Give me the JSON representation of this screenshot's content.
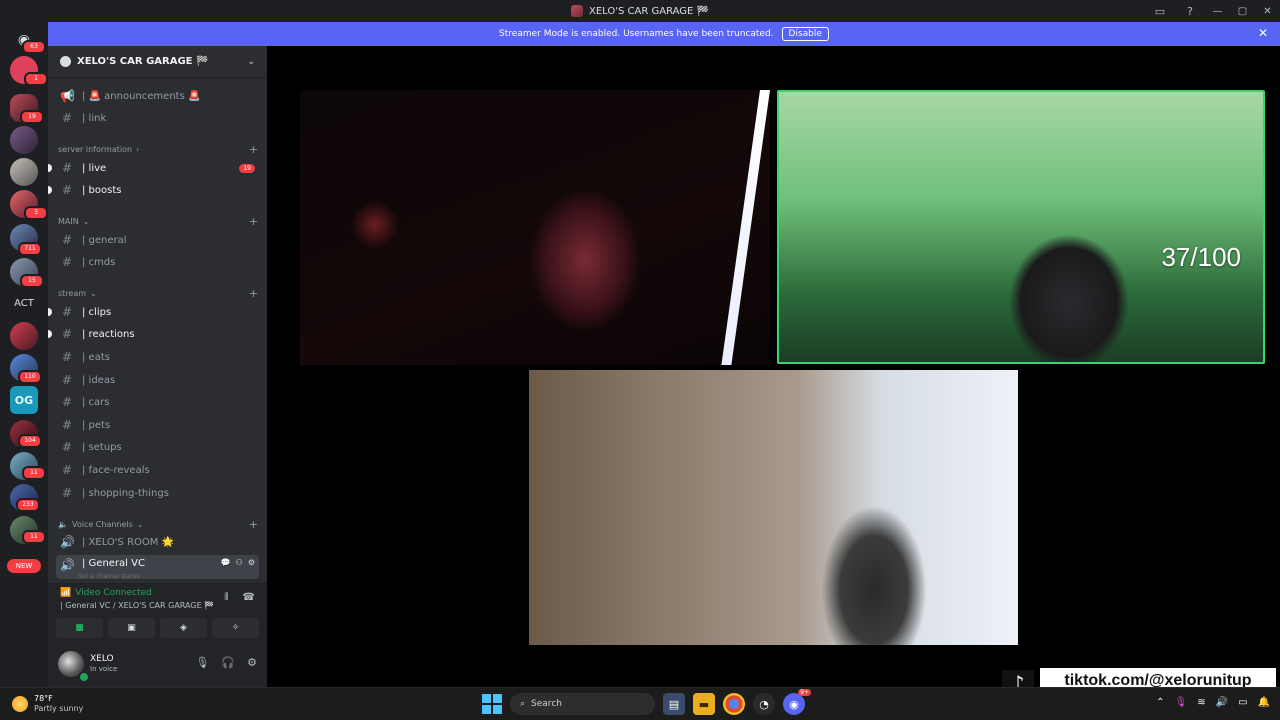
{
  "window": {
    "title": "XELO'S CAR GARAGE 🏁"
  },
  "banner": {
    "message": "Streamer Mode is enabled. Usernames have been truncated.",
    "disable_label": "Disable"
  },
  "rail": {
    "badges": [
      "63",
      "1",
      "19",
      "3",
      "711",
      "15",
      "110",
      "104",
      "11",
      "233",
      "11"
    ],
    "act_label": "ACT",
    "new_label": "NEW"
  },
  "server": {
    "name": "XELO'S CAR GARAGE 🏁"
  },
  "channels": {
    "announcements": "| 🚨 announcements 🚨",
    "link": "| link",
    "cat_server_info": "server information",
    "live": "| live",
    "live_badge": "19",
    "boosts": "| boosts",
    "cat_main": "MAIN",
    "general": "| general",
    "cmds": "| cmds",
    "cat_stream": "stream",
    "clips": "| clips",
    "reactions": "| reactions",
    "eats": "| eats",
    "ideas": "| ideas",
    "cars": "| cars",
    "pets": "| pets",
    "setups": "| setups",
    "face_reveals": "| face-reveals",
    "shopping_things": "| shopping-things",
    "cat_voice": "Voice Channels",
    "xelos_room": "| XELO'S ROOM 🌟",
    "general_vc": "| General VC",
    "general_vc_sub": "Set a channel status"
  },
  "voice": {
    "status": "Video Connected",
    "location": "| General VC / XELO'S CAR GARAGE 🏁"
  },
  "user": {
    "name": "XELO",
    "status": "In voice"
  },
  "video": {
    "counter": "37/100"
  },
  "overlay": {
    "tiktok": "tiktok.com/@xelorunitup"
  },
  "taskbar": {
    "temp": "78°F",
    "condition": "Partly sunny",
    "search": "Search",
    "discord_badge": "9+"
  },
  "colors": {
    "accent": "#5865f2",
    "online": "#23a55a",
    "badge": "#f23f43",
    "speaking": "#3bd36b"
  }
}
